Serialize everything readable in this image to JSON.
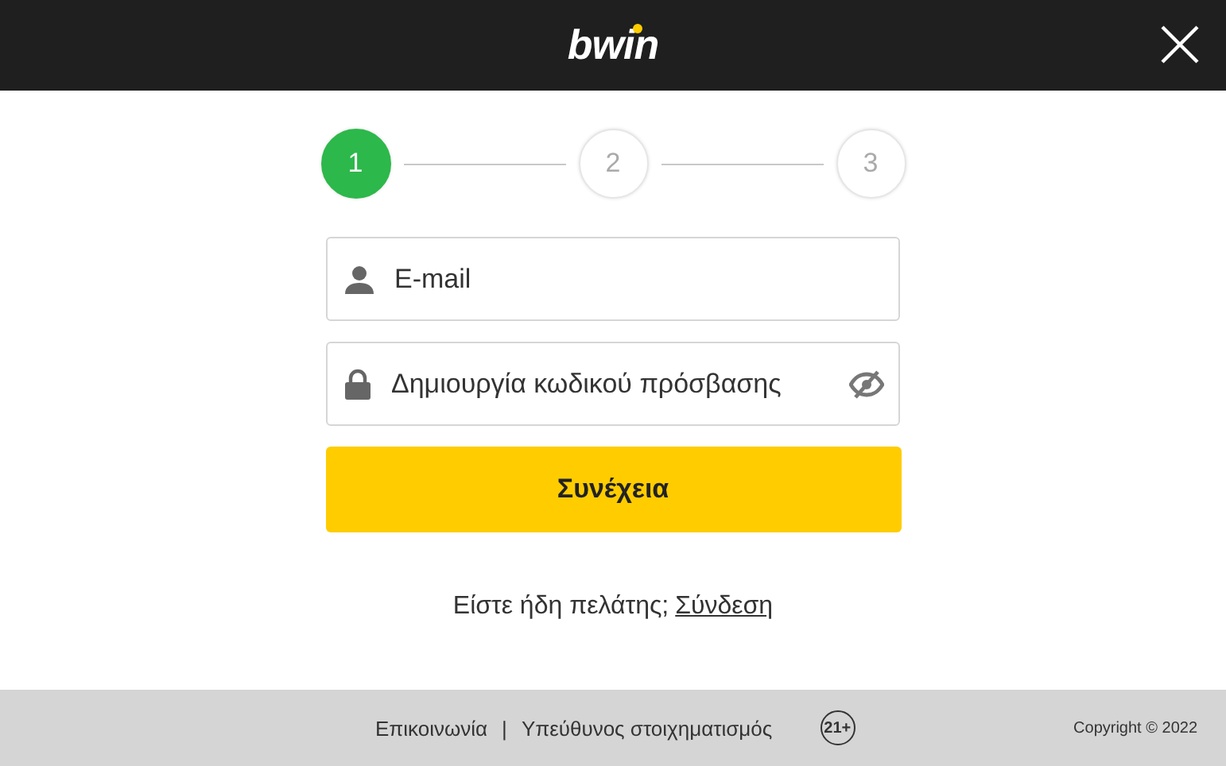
{
  "header": {
    "logo": "bwin"
  },
  "steps": [
    {
      "label": "1",
      "selected": true
    },
    {
      "label": "2",
      "selected": false
    },
    {
      "label": "3",
      "selected": false
    }
  ],
  "fields": [
    {
      "kind": "email",
      "placeholder": "E-mail"
    },
    {
      "kind": "password",
      "placeholder": "Δημιουργία κωδικού πρόσβασης"
    }
  ],
  "continue_button": "Συνέχεια",
  "login_prompt": {
    "text": "Είστε ήδη πελάτης;",
    "link": "Σύνδεση"
  },
  "footer": {
    "links": [
      "Επικοινωνία",
      "Υπεύθυνος στοιχηματισμός"
    ],
    "separator": "|",
    "age_badge": "21+",
    "copyright": "Copyright © 2022"
  }
}
